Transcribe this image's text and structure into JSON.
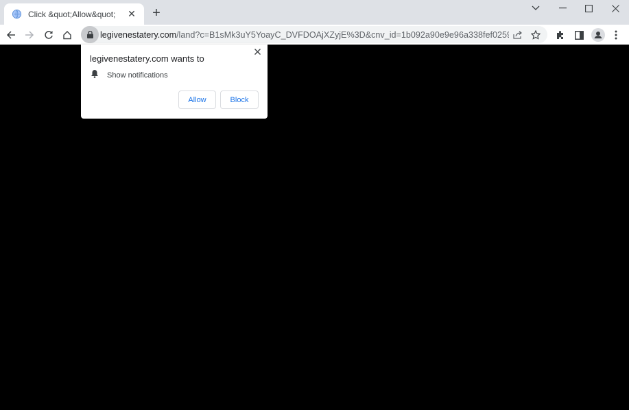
{
  "browser": {
    "tab": {
      "title": "Click &quot;Allow&quot;",
      "favicon": "globe-icon",
      "close_icon": "close-icon"
    },
    "new_tab_icon": "plus-icon",
    "window_controls": [
      "chevron-down-icon",
      "minimize-icon",
      "maximize-icon",
      "close-icon"
    ],
    "toolbar": {
      "nav_icons": [
        "back-arrow-icon",
        "forward-arrow-icon",
        "reload-icon",
        "home-icon"
      ],
      "url_host": "legivenestatery.com",
      "url_rest": "/land?c=B1sMk3uY5YoayC_DVFDOAjXZyjE%3D&cnv_id=1b092a90e9e96a338fef025994d5a...",
      "omnibox_icons": [
        "lock-icon",
        "share-icon",
        "star-icon"
      ],
      "right_icons": [
        "extensions-icon",
        "side-panel-icon",
        "profile-icon",
        "menu-icon"
      ]
    }
  },
  "permission_popup": {
    "title": "legivenestatery.com wants to",
    "permission_label": "Show notifications",
    "permission_icon": "bell-icon",
    "allow_label": "Allow",
    "block_label": "Block",
    "accent_color": "#1a73e8"
  }
}
